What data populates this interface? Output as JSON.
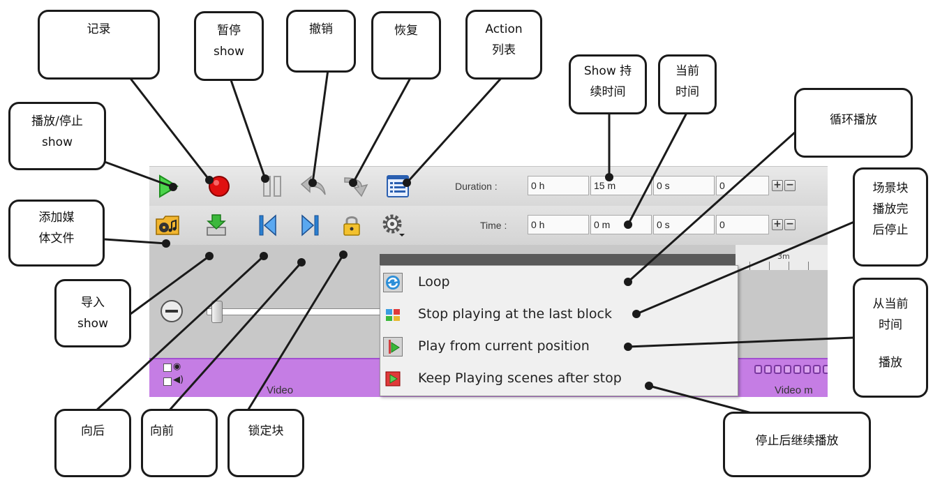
{
  "toolbar_row1": {
    "icons": [
      "play-icon",
      "record-icon",
      "pause-icon",
      "undo-icon",
      "redo-icon",
      "action-list-icon"
    ]
  },
  "toolbar_row2": {
    "icons": [
      "add-media-folder-icon",
      "import-show-icon",
      "step-back-icon",
      "step-forward-icon",
      "lock-icon",
      "settings-gear-icon"
    ]
  },
  "duration": {
    "label": "Duration :",
    "hours": "0 h",
    "minutes": "15 m",
    "seconds": "0 s",
    "frames": "0"
  },
  "time": {
    "label": "Time :",
    "hours": "0 h",
    "minutes": "0 m",
    "seconds": "0 s",
    "frames": "0"
  },
  "ruler": {
    "label": "3m"
  },
  "track": {
    "name": "Video",
    "name_right": "Video m"
  },
  "menu": {
    "items": [
      {
        "label": "Loop",
        "icon": "loop-icon"
      },
      {
        "label": "Stop playing at the last block",
        "icon": "stop-last-block-icon"
      },
      {
        "label": "Play from current position",
        "icon": "play-from-position-icon"
      },
      {
        "label": "Keep Playing scenes after stop",
        "icon": "keep-playing-icon"
      }
    ]
  },
  "callouts": {
    "record": "记录",
    "pause_1": "暂停",
    "pause_2": "show",
    "undo": "撤销",
    "redo": "恢复",
    "action_1": "Action",
    "action_2": "列表",
    "duration_1": "Show 持",
    "duration_2": "续时间",
    "current_1": "当前",
    "current_2": "时间",
    "loop": "循环播放",
    "play_1": "播放/停止",
    "play_2": "show",
    "stop_block_1": "场景块",
    "stop_block_2": "播放完",
    "stop_block_3": "后停止",
    "add_media_1": "添加媒",
    "add_media_2": "体文件",
    "play_from_1": "从当前",
    "play_from_2": "时间",
    "play_from_3": "播放",
    "import_1": "导入",
    "import_2": "show",
    "back": "向后",
    "forward": "向前",
    "lock": "锁定块",
    "keep_playing": "停止后继续播放"
  }
}
